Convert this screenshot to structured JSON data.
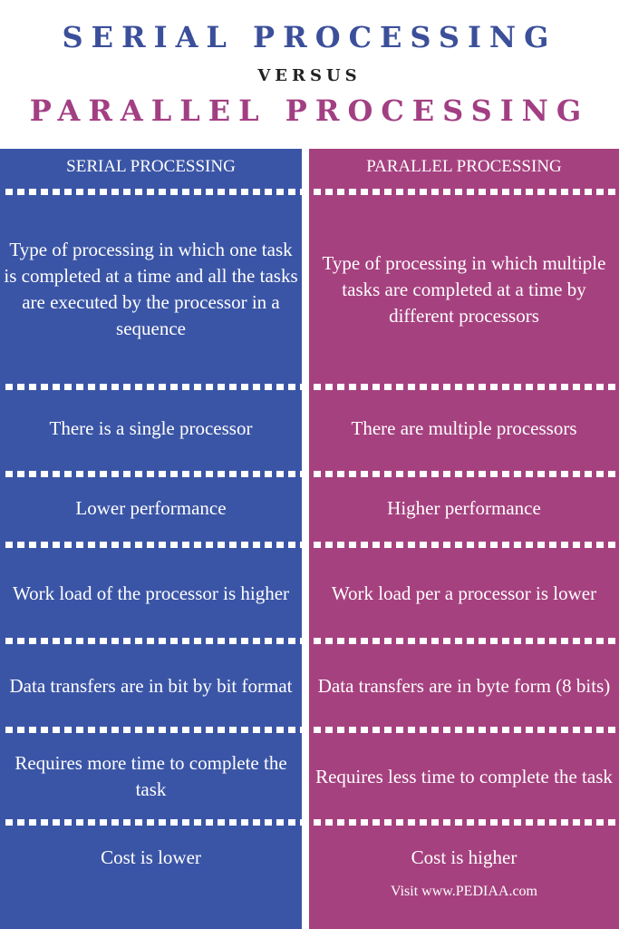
{
  "title": {
    "line1": "SERIAL PROCESSING",
    "line2": "VERSUS",
    "line3": "PARALLEL PROCESSING"
  },
  "headers": {
    "serial": "SERIAL PROCESSING",
    "parallel": "PARALLEL PROCESSING"
  },
  "rows": [
    {
      "serial": "Type of processing in which one task is completed at a time and all the tasks are executed by the processor in a sequence",
      "parallel": "Type of processing in which multiple tasks are completed at a time by different processors"
    },
    {
      "serial": "There is a single processor",
      "parallel": "There are multiple processors"
    },
    {
      "serial": "Lower performance",
      "parallel": "Higher performance"
    },
    {
      "serial": "Work load of the processor is higher",
      "parallel": "Work load per a processor is lower"
    },
    {
      "serial": "Data transfers are in bit by bit format",
      "parallel": "Data transfers are in byte form (8 bits)"
    },
    {
      "serial": "Requires more time to complete the task",
      "parallel": "Requires less time to complete the task"
    },
    {
      "serial": "Cost is lower",
      "parallel": "Cost is higher"
    }
  ],
  "footer": "Visit www.PEDIAA.com",
  "colors": {
    "serial": "#3b55a6",
    "parallel": "#a6417f",
    "title_serial": "#3b4f9a",
    "title_parallel": "#a23f83"
  }
}
